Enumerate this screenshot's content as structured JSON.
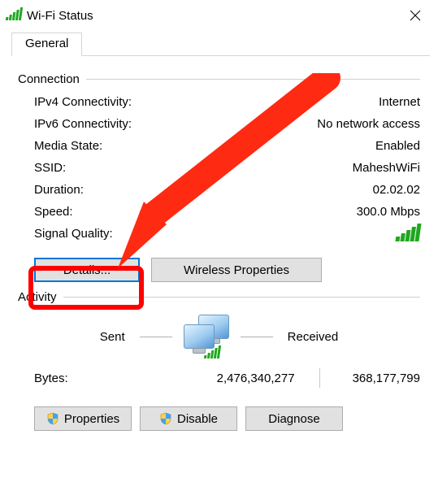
{
  "window": {
    "title": "Wi-Fi Status"
  },
  "tab": {
    "general": "General"
  },
  "groups": {
    "connection": "Connection",
    "activity": "Activity"
  },
  "conn": {
    "ipv4_label": "IPv4 Connectivity:",
    "ipv4_value": "Internet",
    "ipv6_label": "IPv6 Connectivity:",
    "ipv6_value": "No network access",
    "media_label": "Media State:",
    "media_value": "Enabled",
    "ssid_label": "SSID:",
    "ssid_value": "MaheshWiFi",
    "duration_label": "Duration:",
    "duration_value": "02.02.02",
    "speed_label": "Speed:",
    "speed_value": "300.0 Mbps",
    "signal_label": "Signal Quality:"
  },
  "buttons": {
    "details": "Details...",
    "wireless_properties": "Wireless Properties",
    "properties": "Properties",
    "disable": "Disable",
    "diagnose": "Diagnose"
  },
  "activity": {
    "sent_label": "Sent",
    "received_label": "Received",
    "bytes_label": "Bytes:",
    "bytes_sent": "2,476,340,277",
    "bytes_received": "368,177,799"
  },
  "annotation": {
    "arrow_color": "#ff2a12",
    "highlight_color": "#ff0000"
  }
}
